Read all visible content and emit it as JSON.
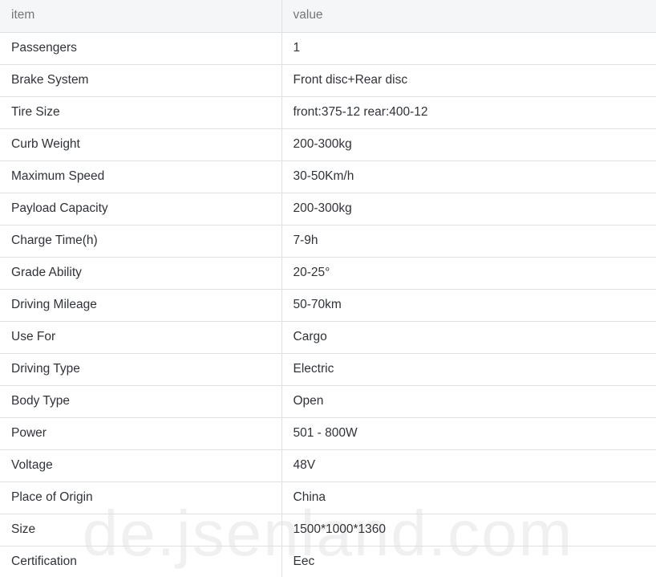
{
  "table": {
    "columns": [
      "item",
      "value"
    ],
    "rows": [
      {
        "item": "Passengers",
        "value": "1"
      },
      {
        "item": "Brake System",
        "value": "Front disc+Rear disc"
      },
      {
        "item": "Tire Size",
        "value": "front:375-12 rear:400-12"
      },
      {
        "item": "Curb Weight",
        "value": "200-300kg"
      },
      {
        "item": "Maximum Speed",
        "value": "30-50Km/h"
      },
      {
        "item": "Payload Capacity",
        "value": "200-300kg"
      },
      {
        "item": "Charge Time(h)",
        "value": "7-9h"
      },
      {
        "item": "Grade Ability",
        "value": "20-25°"
      },
      {
        "item": "Driving Mileage",
        "value": "50-70km"
      },
      {
        "item": "Use For",
        "value": "Cargo"
      },
      {
        "item": "Driving Type",
        "value": "Electric"
      },
      {
        "item": "Body Type",
        "value": "Open"
      },
      {
        "item": "Power",
        "value": "501 - 800W"
      },
      {
        "item": "Voltage",
        "value": "48V"
      },
      {
        "item": "Place of Origin",
        "value": "China"
      },
      {
        "item": "Size",
        "value": "1500*1000*1360"
      },
      {
        "item": "Certification",
        "value": "Eec"
      }
    ]
  },
  "watermark": {
    "text": "de.jsenland.com"
  },
  "colors": {
    "header_background": "#f5f6f8",
    "header_text": "#73777c",
    "body_text": "#2f3338",
    "border": "#dcdfe3",
    "watermark_text": "#f0f0f0"
  }
}
